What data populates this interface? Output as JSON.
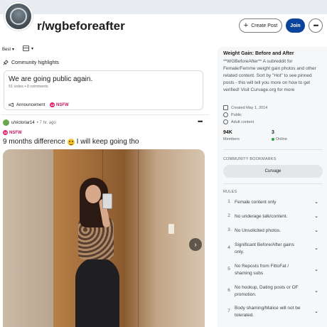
{
  "header": {
    "subreddit": "r/wgbeforeafter",
    "create_post": "Create Post",
    "join": "Join",
    "more": "•••"
  },
  "feed_controls": {
    "sort": "Best",
    "sort_chevron": "▾",
    "view_chevron": "▾"
  },
  "highlights": {
    "title": "Community highlights",
    "card": {
      "heading": "We are going public again.",
      "meta": "51 votes • 0 comments",
      "announcement": "Announcement",
      "nsfw": "NSFW"
    }
  },
  "post": {
    "author": "u/victoriar14",
    "time": "• 7 hr. ago",
    "more": "•••",
    "nsfw": "NSFW",
    "title_before": "9 months difference",
    "title_after": "I will keep going tho",
    "next": "›"
  },
  "sidebar": {
    "title": "Weight Gain: Before and After",
    "description": "**WGBeforeAfter** A subreddit for Female/Femme weight gain photos and other related content. Sort by \"Hot\" to see pinned posts - this will tell you more on how to get verified! Visit Curvage.org for more",
    "created": "Created May 1, 2014",
    "visibility": "Public",
    "adult": "Adult content",
    "members_count": "94K",
    "members_label": "Members",
    "online_count": "3",
    "online_label": "Online",
    "bookmarks_heading": "COMMUNITY BOOKMARKS",
    "bookmark_button": "Curvage",
    "rules_heading": "RULES",
    "rules": [
      {
        "n": "1",
        "text": "Female content only"
      },
      {
        "n": "2",
        "text": "No underage talk/content."
      },
      {
        "n": "3",
        "text": "No Unsolicited photos."
      },
      {
        "n": "4",
        "text": "Significant Before/After gains only."
      },
      {
        "n": "5",
        "text": "No Reposts from FittoFat / shaming subs"
      },
      {
        "n": "6",
        "text": "No hookup, Dating posts or OF promotion."
      },
      {
        "n": "7",
        "text": "Body shaming/Malice will not be tolerated."
      }
    ]
  },
  "icons": {
    "pin": "pin-icon",
    "announcement": "megaphone-icon",
    "created": "cake-icon",
    "public": "globe-icon",
    "adult": "eye-icon"
  }
}
